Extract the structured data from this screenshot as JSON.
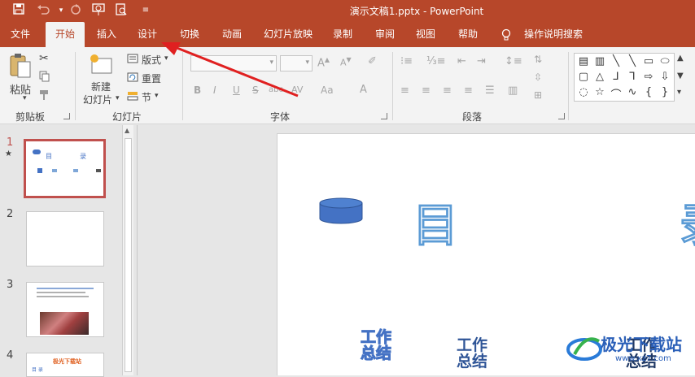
{
  "titlebar": {
    "title": "演示文稿1.pptx  -  PowerPoint",
    "icons": [
      "save-icon",
      "undo-icon",
      "redo-icon",
      "slideshow-icon",
      "preview-icon",
      "customize-icon"
    ]
  },
  "tabs": [
    "文件",
    "开始",
    "插入",
    "设计",
    "切换",
    "动画",
    "幻灯片放映",
    "录制",
    "审阅",
    "视图",
    "帮助",
    "操作说明搜索"
  ],
  "active_tab": "开始",
  "ribbon": {
    "clipboard": {
      "paste": "粘贴",
      "group": "剪贴板"
    },
    "slides": {
      "new_slide_line1": "新建",
      "new_slide_line2": "幻灯片",
      "layout": "版式",
      "reset": "重置",
      "section": "节",
      "group": "幻灯片"
    },
    "font": {
      "bold": "B",
      "italic": "I",
      "underline": "U",
      "strike": "S",
      "shadow": "abc",
      "spacing": "AV",
      "case": "Aa",
      "color": "A",
      "group": "字体"
    },
    "paragraph": {
      "group": "段落"
    }
  },
  "thumbnails": [
    {
      "num": "1",
      "star": "★",
      "title_a": "目",
      "title_b": "录"
    },
    {
      "num": "2"
    },
    {
      "num": "3"
    },
    {
      "num": "4",
      "caption": "极光下载站",
      "sub": "目 录"
    }
  ],
  "slide": {
    "title_char": "目",
    "title_char2": "录",
    "item1": "工作总结",
    "item2": "工作总结",
    "item3": "工作总结"
  },
  "watermark": {
    "text": "极光下载站",
    "url": "www.xz7.com"
  },
  "colors": {
    "accent": "#b7472a",
    "slide_blue": "#4472c4",
    "arrow_red": "#e02020"
  }
}
